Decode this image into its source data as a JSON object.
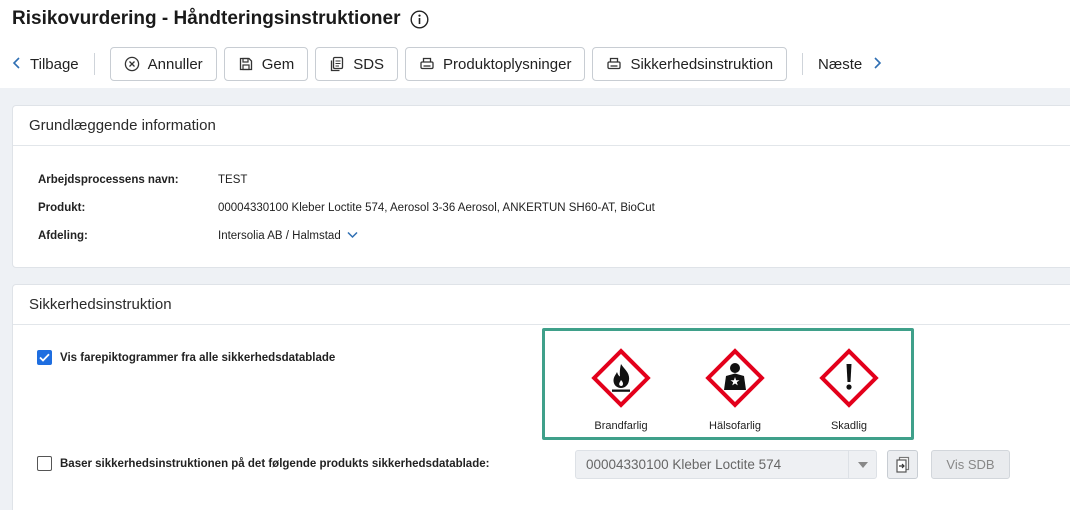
{
  "header": {
    "title": "Risikovurdering - Håndteringsinstruktioner",
    "toolbar": {
      "back_label": "Tilbage",
      "cancel_label": "Annuller",
      "save_label": "Gem",
      "sds_label": "SDS",
      "product_info_label": "Produktoplysninger",
      "safety_instruction_label": "Sikkerhedsinstruktion",
      "next_label": "Næste"
    }
  },
  "basic_info": {
    "title": "Grundlæggende information",
    "rows": [
      {
        "label": "Arbejdsprocessens navn:",
        "value": "TEST"
      },
      {
        "label": "Produkt:",
        "value": "00004330100 Kleber Loctite 574, Aerosol 3-36 Aerosol, ANKERTUN SH60-AT, BioCut"
      },
      {
        "label": "Afdeling:",
        "value": "Intersolia AB / Halmstad"
      }
    ]
  },
  "safety": {
    "title": "Sikkerhedsinstruktion",
    "show_pictograms_label": "Vis farepiktogrammer fra alle sikkerhedsdatablade",
    "show_pictograms_checked": true,
    "pictograms": [
      {
        "icon": "flame-icon",
        "label": "Brandfarlig"
      },
      {
        "icon": "health-hazard-icon",
        "label": "Hälsofarlig"
      },
      {
        "icon": "exclamation-icon",
        "label": "Skadlig"
      }
    ],
    "base_on_product_label": "Baser sikkerhedsinstruktionen på det følgende produkts sikkerhedsdatablade:",
    "base_on_product_checked": false,
    "product_select_value": "00004330100 Kleber Loctite 574",
    "view_sds_label": "Vis SDB"
  },
  "colors": {
    "accent": "#1e6ee0",
    "highlight_border": "#3fa08a",
    "hazard_red": "#e3001b"
  }
}
